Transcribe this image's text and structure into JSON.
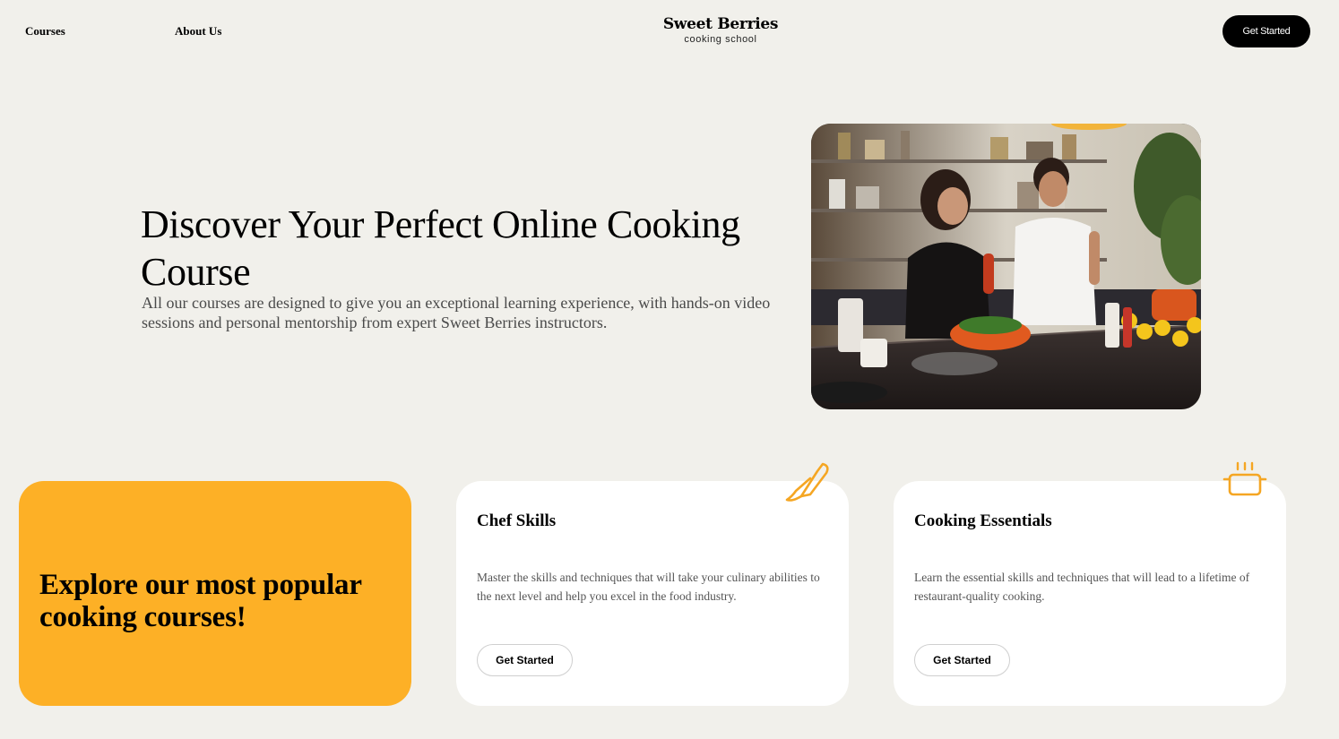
{
  "nav": {
    "courses": "Courses",
    "about": "About Us"
  },
  "brand": {
    "name": "Sweet Berries",
    "subtitle": "cooking school"
  },
  "header": {
    "cta_label": "Get Started"
  },
  "hero": {
    "title": "Discover Your Perfect Online Cooking Course",
    "description": "All our courses are designed to give you an exceptional learning experience, with hands-on video sessions and personal mentorship from expert Sweet Berries instructors.",
    "image_subject": "couple cooking in a kitchen"
  },
  "promo": {
    "title": "Explore our most popular cooking courses!",
    "color": "#fdb026"
  },
  "courses": [
    {
      "title": "Chef Skills",
      "description": "Master the skills and techniques that will take your culinary abilities to the next level and help you excel in the food industry.",
      "button": "Get Started",
      "icon": "knife-icon"
    },
    {
      "title": "Cooking Essentials",
      "description": "Learn the essential skills and techniques that will lead to a lifetime of restaurant-quality cooking.",
      "button": "Get Started",
      "icon": "pot-icon"
    }
  ],
  "colors": {
    "background": "#f1f0eb",
    "accent": "#fdb026",
    "icon": "#f5a623",
    "dark": "#000000"
  }
}
